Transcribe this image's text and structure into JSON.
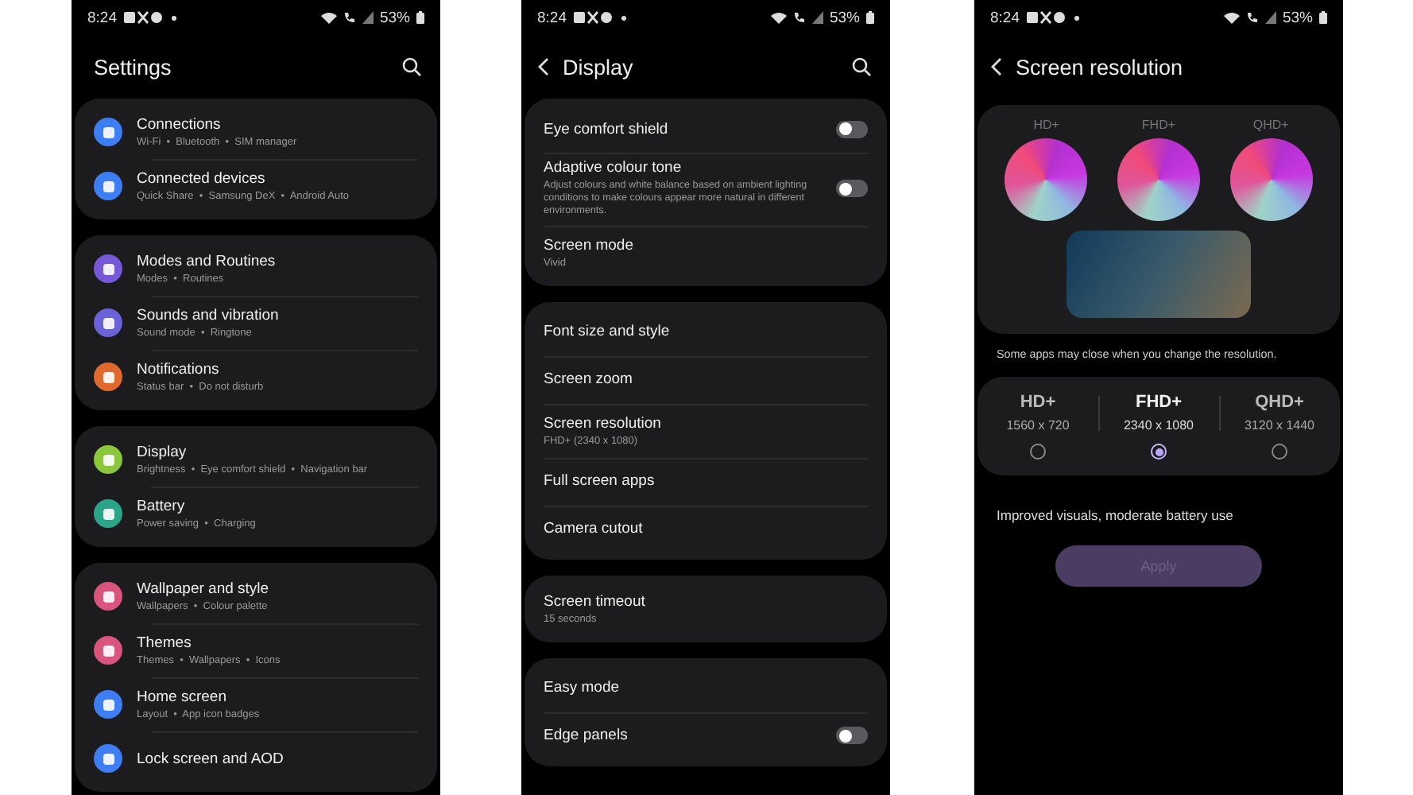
{
  "phones": [
    {
      "kind": "list",
      "status_bar": {
        "time": "8:24",
        "battery": "53%"
      },
      "header": {
        "title": "Settings",
        "back": false,
        "search": true
      },
      "groups": [
        {
          "items": [
            {
              "kind": "link",
              "title": "Connections",
              "subtitle": "Wi-Fi  •  Bluetooth  •  SIM manager",
              "color": "#3d7ef2"
            },
            {
              "kind": "link",
              "title": "Connected devices",
              "subtitle": "Quick Share  •  Samsung DeX  •  Android Auto",
              "color": "#3d7ef2"
            }
          ]
        },
        {
          "items": [
            {
              "kind": "link",
              "title": "Modes and Routines",
              "subtitle": "Modes  •  Routines",
              "color": "#7658d8"
            },
            {
              "kind": "link",
              "title": "Sounds and vibration",
              "subtitle": "Sound mode  •  Ringtone",
              "color": "#6a62d6"
            },
            {
              "kind": "link",
              "title": "Notifications",
              "subtitle": "Status bar  •  Do not disturb",
              "color": "#e06a2e"
            }
          ]
        },
        {
          "items": [
            {
              "kind": "link",
              "title": "Display",
              "subtitle": "Brightness  •  Eye comfort shield  •  Navigation bar",
              "color": "#8cc63a"
            },
            {
              "kind": "link",
              "title": "Battery",
              "subtitle": "Power saving  •  Charging",
              "color": "#2aa58a"
            }
          ]
        },
        {
          "items": [
            {
              "kind": "link",
              "title": "Wallpaper and style",
              "subtitle": "Wallpapers  •  Colour palette",
              "color": "#d9557e"
            },
            {
              "kind": "link",
              "title": "Themes",
              "subtitle": "Themes  •  Wallpapers  •  Icons",
              "color": "#d9557e"
            },
            {
              "kind": "link",
              "title": "Home screen",
              "subtitle": "Layout  •  App icon badges",
              "color": "#3d7ef2"
            },
            {
              "kind": "link",
              "title": "Lock screen and AOD",
              "color": "#3d7ef2"
            }
          ]
        }
      ]
    },
    {
      "kind": "list",
      "status_bar": {
        "time": "8:24",
        "battery": "53%"
      },
      "header": {
        "title": "Display",
        "back": true,
        "search": true
      },
      "groups": [
        {
          "items": [
            {
              "kind": "toggle",
              "title": "Eye comfort shield",
              "on": false
            },
            {
              "kind": "toggle",
              "title": "Adaptive colour tone",
              "description": "Adjust colours and white balance based on ambient lighting conditions to make colours appear more natural in different environments.",
              "on": false
            },
            {
              "kind": "link",
              "title": "Screen mode",
              "subtitle": "Vivid"
            }
          ]
        },
        {
          "items": [
            {
              "kind": "link",
              "title": "Font size and style"
            },
            {
              "kind": "link",
              "title": "Screen zoom"
            },
            {
              "kind": "link",
              "title": "Screen resolution",
              "subtitle": "FHD+ (2340 x 1080)"
            },
            {
              "kind": "link",
              "title": "Full screen apps"
            },
            {
              "kind": "link",
              "title": "Camera cutout"
            }
          ]
        },
        {
          "items": [
            {
              "kind": "link",
              "title": "Screen timeout",
              "subtitle": "15 seconds"
            }
          ]
        },
        {
          "items": [
            {
              "kind": "link",
              "title": "Easy mode"
            },
            {
              "kind": "toggle",
              "title": "Edge panels",
              "on": false
            }
          ]
        }
      ]
    },
    {
      "kind": "resolution",
      "status_bar": {
        "time": "8:24",
        "battery": "53%"
      },
      "header": {
        "title": "Screen resolution",
        "back": true,
        "search": false
      },
      "preview_labels": [
        "HD+",
        "FHD+",
        "QHD+"
      ],
      "note": "Some apps may close when you change the resolution.",
      "options": [
        {
          "name": "HD+",
          "size": "1560 x 720",
          "selected": false
        },
        {
          "name": "FHD+",
          "size": "2340 x 1080",
          "selected": true
        },
        {
          "name": "QHD+",
          "size": "3120 x 1440",
          "selected": false
        }
      ],
      "description": "Improved visuals, moderate battery use",
      "apply": {
        "label": "Apply",
        "disabled": true
      }
    }
  ]
}
